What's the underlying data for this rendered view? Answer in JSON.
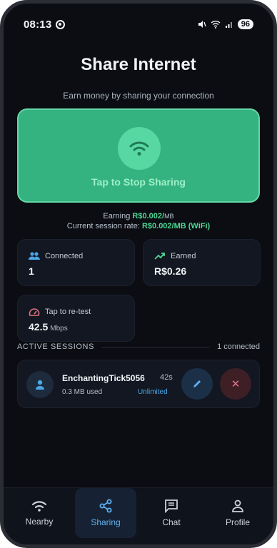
{
  "status": {
    "time": "08:13",
    "battery": "96"
  },
  "header": {
    "title": "Share Internet",
    "subtitle": "Earn money by sharing your connection"
  },
  "share": {
    "label": "Tap to Stop Sharing"
  },
  "earning": {
    "prefix": "Earning",
    "amount": "R$0.002/",
    "unit": "MB",
    "rate_prefix": "Current session rate:",
    "rate_value": "R$0.002/MB (WiFi)"
  },
  "stats": {
    "connected": {
      "label": "Connected",
      "value": "1"
    },
    "earned": {
      "label": "Earned",
      "value": "R$0.26"
    },
    "speed": {
      "label": "Tap to re-test",
      "value": "42.5",
      "unit": "Mbps"
    }
  },
  "sessions": {
    "heading": "ACTIVE SESSIONS",
    "count": "1 connected",
    "items": [
      {
        "name": "EnchantingTick5056",
        "time": "42s",
        "used": "0.3 MB used",
        "plan": "Unlimited"
      }
    ]
  },
  "nav": {
    "items": [
      {
        "label": "Nearby",
        "icon": "wifi-icon"
      },
      {
        "label": "Sharing",
        "icon": "share-icon"
      },
      {
        "label": "Chat",
        "icon": "chat-icon"
      },
      {
        "label": "Profile",
        "icon": "person-icon"
      }
    ],
    "active": "Sharing"
  },
  "colors": {
    "accent_green": "#34b27f",
    "accent_blue": "#5fb0f0",
    "background": "#0b0d12"
  }
}
